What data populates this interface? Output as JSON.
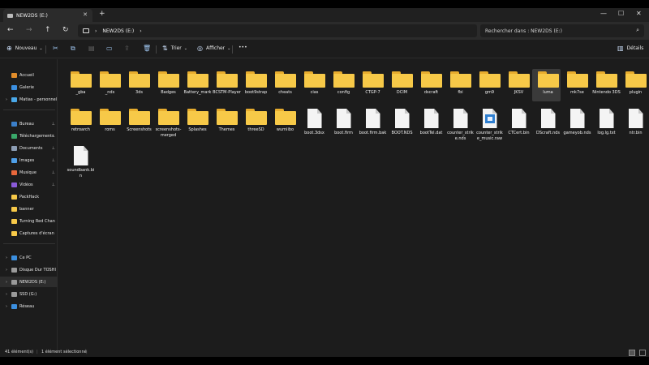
{
  "window": {
    "tab_title": "NEW2DS (E:)",
    "new_tab": "+",
    "minimize": "—",
    "maximize": "☐",
    "close": "✕"
  },
  "nav": {
    "back": "←",
    "forward": "→",
    "up": "↑",
    "refresh": "↻",
    "breadcrumb": [
      "NEW2DS (E:)",
      "›"
    ],
    "breadcrumb_sep": "›",
    "search_placeholder": "Rechercher dans : NEW2DS (E:)"
  },
  "toolbar": {
    "new": "Nouveau",
    "sort": "Trier",
    "view": "Afficher",
    "more": "•••",
    "details": "Détails"
  },
  "sidebar": [
    {
      "label": "Accueil",
      "icon": "home-icon",
      "color": "#e08c2a",
      "chevron": ""
    },
    {
      "label": "Galerie",
      "icon": "gallery-icon",
      "color": "#3b8fe0",
      "chevron": ""
    },
    {
      "label": "Matias - personnel",
      "icon": "cloud-icon",
      "color": "#4aa8e8",
      "chevron": "›"
    },
    {
      "label": "Bureau",
      "icon": "desktop-icon",
      "color": "#3b7fc9",
      "pin": "📌"
    },
    {
      "label": "Téléchargements",
      "icon": "download-icon",
      "color": "#39a86a",
      "pin": "📌"
    },
    {
      "label": "Documents",
      "icon": "documents-icon",
      "color": "#8c9db4",
      "pin": "📌"
    },
    {
      "label": "Images",
      "icon": "images-icon",
      "color": "#4f9fe8",
      "pin": "📌"
    },
    {
      "label": "Musique",
      "icon": "music-icon",
      "color": "#e8673b",
      "pin": "📌"
    },
    {
      "label": "Vidéos",
      "icon": "videos-icon",
      "color": "#8a5ad8",
      "pin": "📌"
    },
    {
      "label": "PackHack",
      "icon": "folder-icon",
      "color": "#f7c948"
    },
    {
      "label": "banner",
      "icon": "folder-icon",
      "color": "#f7c948"
    },
    {
      "label": "Turning Red Chan",
      "icon": "folder-icon",
      "color": "#f7c948"
    },
    {
      "label": "Captures d'écran",
      "icon": "folder-icon",
      "color": "#f7c948"
    },
    {
      "label": "Ce PC",
      "icon": "pc-icon",
      "color": "#3b8fe0",
      "chevron": "›"
    },
    {
      "label": "Disque Dur TOSHI",
      "icon": "drive-icon",
      "color": "#9a9a9a",
      "chevron": "›"
    },
    {
      "label": "NEW2DS (E:)",
      "icon": "drive-icon",
      "color": "#9a9a9a",
      "chevron": "›",
      "selected": true
    },
    {
      "label": "SSD (G:)",
      "icon": "drive-icon",
      "color": "#9a9a9a",
      "chevron": "›"
    },
    {
      "label": "Réseau",
      "icon": "network-icon",
      "color": "#3b8fe0",
      "chevron": "›"
    }
  ],
  "items": [
    {
      "name": "_gba",
      "kind": "folder"
    },
    {
      "name": "_nds",
      "kind": "folder"
    },
    {
      "name": "3ds",
      "kind": "folder"
    },
    {
      "name": "Badges",
      "kind": "folder-thumb"
    },
    {
      "name": "Battery_mark",
      "kind": "folder"
    },
    {
      "name": "BCSTM-Player",
      "kind": "folder"
    },
    {
      "name": "boot9strap",
      "kind": "folder"
    },
    {
      "name": "cheats",
      "kind": "folder"
    },
    {
      "name": "cias",
      "kind": "folder"
    },
    {
      "name": "config",
      "kind": "folder"
    },
    {
      "name": "CTGP-7",
      "kind": "folder"
    },
    {
      "name": "DCIM",
      "kind": "folder"
    },
    {
      "name": "dscraft",
      "kind": "folder"
    },
    {
      "name": "fbi",
      "kind": "folder"
    },
    {
      "name": "gm9",
      "kind": "folder"
    },
    {
      "name": "JKSV",
      "kind": "folder"
    },
    {
      "name": "luma",
      "kind": "folder",
      "selected": true
    },
    {
      "name": "mk7se",
      "kind": "folder"
    },
    {
      "name": "Nintendo 3DS",
      "kind": "folder"
    },
    {
      "name": "plugin",
      "kind": "folder"
    },
    {
      "name": "retroarch",
      "kind": "folder"
    },
    {
      "name": "roms",
      "kind": "folder"
    },
    {
      "name": "Screenshots",
      "kind": "folder"
    },
    {
      "name": "screenshots-merged",
      "kind": "folder"
    },
    {
      "name": "Splashes",
      "kind": "folder"
    },
    {
      "name": "Themes",
      "kind": "folder"
    },
    {
      "name": "threeSD",
      "kind": "folder"
    },
    {
      "name": "wumiibo",
      "kind": "folder"
    },
    {
      "name": "boot.3dsx",
      "kind": "file"
    },
    {
      "name": "boot.firm",
      "kind": "file"
    },
    {
      "name": "boot.firm.bak",
      "kind": "file"
    },
    {
      "name": "BOOT.NDS",
      "kind": "file"
    },
    {
      "name": "bootTel.dat",
      "kind": "file"
    },
    {
      "name": "counter_strike.nds",
      "kind": "file"
    },
    {
      "name": "counter_strike_music.raw",
      "kind": "file-image"
    },
    {
      "name": "CTCert.bin",
      "kind": "file"
    },
    {
      "name": "DScraft.nds",
      "kind": "file"
    },
    {
      "name": "gameyob.nds",
      "kind": "file"
    },
    {
      "name": "log.lg.txt",
      "kind": "file"
    },
    {
      "name": "ntr.bin",
      "kind": "file"
    },
    {
      "name": "soundbank.bin",
      "kind": "file"
    }
  ],
  "status": {
    "count": "41 élément(s)",
    "selection": "1 élément sélectionné"
  }
}
